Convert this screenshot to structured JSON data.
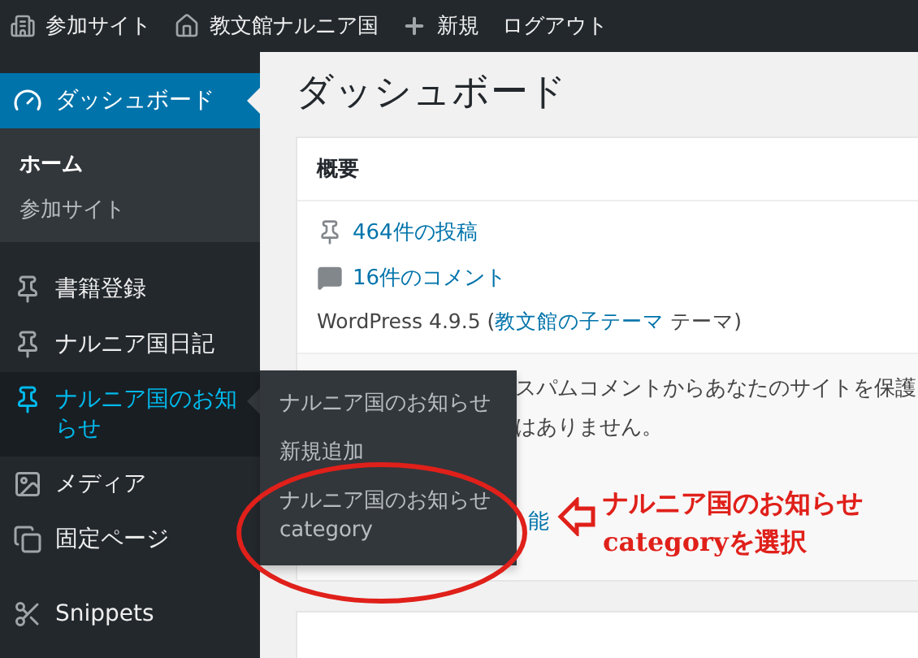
{
  "admin_bar": {
    "items": [
      {
        "kind": "sites",
        "label": "参加サイト"
      },
      {
        "kind": "home",
        "label": "教文館ナルニア国"
      },
      {
        "kind": "new",
        "label": "新規"
      },
      {
        "kind": "plain",
        "label": "ログアウト"
      }
    ]
  },
  "sidebar": {
    "items": [
      {
        "kind": "dashboard",
        "label": "ダッシュボード",
        "selected": true,
        "hovered": false,
        "group_start": false,
        "children": [
          {
            "label": "ホーム",
            "selected": true
          },
          {
            "label": "参加サイト",
            "selected": false
          }
        ]
      },
      {
        "kind": "pin",
        "label": "書籍登録",
        "selected": false,
        "hovered": false,
        "group_start": true
      },
      {
        "kind": "pin",
        "label": "ナルニア国日記",
        "selected": false,
        "hovered": false,
        "group_start": false
      },
      {
        "kind": "pin",
        "label": "ナルニア国のお知らせ",
        "selected": false,
        "hovered": true,
        "group_start": false
      },
      {
        "kind": "media",
        "label": "メディア",
        "selected": false,
        "hovered": false,
        "group_start": false
      },
      {
        "kind": "pages",
        "label": "固定ページ",
        "selected": false,
        "hovered": false,
        "group_start": false
      },
      {
        "kind": "scissors",
        "label": "Snippets",
        "selected": false,
        "hovered": false,
        "group_start": true
      }
    ]
  },
  "flyout": {
    "items": [
      {
        "label": "ナルニア国のお知らせ"
      },
      {
        "label": "新規追加"
      },
      {
        "label": "ナルニア国のお知らせ category"
      }
    ]
  },
  "page_title": "ダッシュボード",
  "overview": {
    "title": "概要",
    "stats": [
      {
        "kind": "pin",
        "label": "464件の投稿"
      },
      {
        "kind": "comment",
        "label": "16件のコメント"
      }
    ],
    "version": {
      "prefix": "WordPress 4.9.5 (",
      "link": "教文館の子テーマ",
      "suffix": " テーマ)"
    },
    "notice_lines": [
      "スパムコメントからあなたのサイトを保護",
      "はありません。"
    ],
    "notice_link": "能"
  },
  "annotation": {
    "lines": [
      "ナルニア国のお知らせ",
      "categoryを選択"
    ]
  }
}
